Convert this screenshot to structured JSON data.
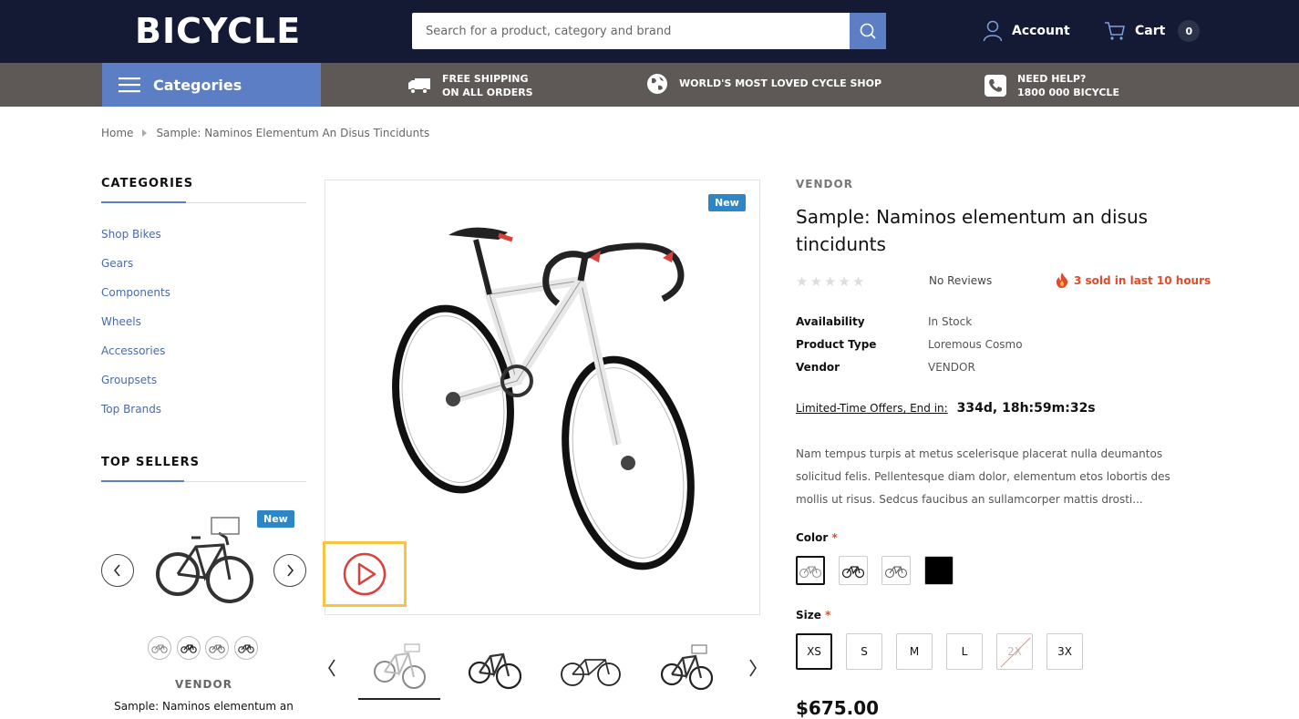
{
  "header": {
    "logo": "BICYCLE",
    "search_placeholder": "Search for a product, category and brand",
    "account_label": "Account",
    "cart_label": "Cart",
    "cart_count": "0"
  },
  "nav": {
    "categories_label": "Categories",
    "features": [
      {
        "line1": "FREE SHIPPING",
        "line2": "ON ALL ORDERS",
        "icon": "truck-icon"
      },
      {
        "line1": "WORLD'S MOST LOVED CYCLE SHOP",
        "line2": "",
        "icon": "globe-icon"
      },
      {
        "line1": "NEED HELP?",
        "line2": "1800 000 BICYCLE",
        "icon": "phone-icon"
      }
    ]
  },
  "breadcrumb": {
    "home": "Home",
    "current": "Sample: Naminos Elementum An Disus Tincidunts"
  },
  "sidebar": {
    "categories_title": "CATEGORIES",
    "categories": [
      "Shop Bikes",
      "Gears",
      "Components",
      "Wheels",
      "Accessories",
      "Groupsets",
      "Top Brands"
    ],
    "top_sellers_title": "TOP SELLERS",
    "top_seller": {
      "badge": "New",
      "vendor": "VENDOR",
      "title": "Sample: Naminos elementum an"
    }
  },
  "product": {
    "badge": "New",
    "vendor": "VENDOR",
    "title": "Sample: Naminos elementum an disus tincidunts",
    "rating_stars": 0,
    "reviews": "No Reviews",
    "sold": "3 sold in last 10 hours",
    "meta": [
      {
        "key": "Availability",
        "value": "In Stock"
      },
      {
        "key": "Product Type",
        "value": "Loremous Cosmo"
      },
      {
        "key": "Vendor",
        "value": "VENDOR"
      }
    ],
    "offer_label": "Limited-Time Offers, End in:",
    "countdown": "334d, 18h:59m:32s",
    "description": "Nam tempus turpis at metus scelerisque placerat nulla deumantos solicitud felis. Pellentesque diam dolor, elementum etos lobortis des mollis ut risus. Sedcus faucibus an sullamcorper mattis drosti...",
    "color_label": "Color",
    "size_label": "Size",
    "required_mark": "*",
    "sizes": [
      "XS",
      "S",
      "M",
      "L",
      "2X",
      "3X"
    ],
    "selected_size": "XS",
    "disabled_size": "2X",
    "price": "$675.00"
  },
  "colors": {
    "header_bg": "#141a33",
    "nav_bg": "#5e5957",
    "accent": "#5b7ec4",
    "badge": "#2d86c6",
    "hot": "#e2492a",
    "video_highlight": "#f5c542"
  }
}
